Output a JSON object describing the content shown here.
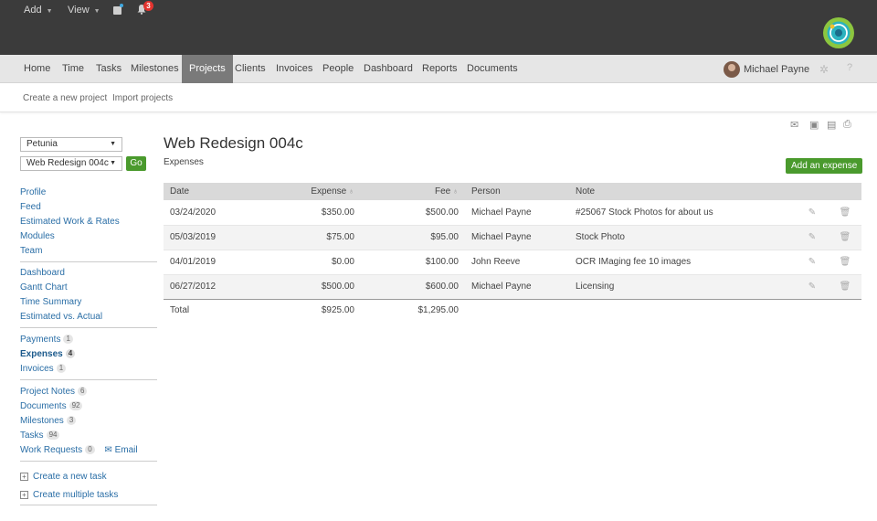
{
  "topbar": {
    "add_label": "Add",
    "view_label": "View",
    "notification_count": "3"
  },
  "nav": {
    "items": [
      "Home",
      "Time",
      "Tasks",
      "Milestones",
      "Projects",
      "Clients",
      "Invoices",
      "People",
      "Dashboard",
      "Reports",
      "Documents"
    ],
    "active": "Projects",
    "user_name": "Michael Payne",
    "help": "?"
  },
  "subbar": {
    "create_project": "Create a new project",
    "import_projects": "Import projects"
  },
  "sidebar": {
    "client_select": "Petunia",
    "project_select": "Web Redesign 004c",
    "go_label": "Go",
    "group1": [
      "Profile",
      "Feed",
      "Estimated Work & Rates",
      "Modules",
      "Team"
    ],
    "group2": [
      "Dashboard",
      "Gantt Chart",
      "Time Summary",
      "Estimated vs. Actual"
    ],
    "payments": {
      "label": "Payments",
      "count": "1"
    },
    "expenses": {
      "label": "Expenses",
      "count": "4"
    },
    "invoices": {
      "label": "Invoices",
      "count": "1"
    },
    "project_notes": {
      "label": "Project Notes",
      "count": "6"
    },
    "documents": {
      "label": "Documents",
      "count": "92"
    },
    "milestones": {
      "label": "Milestones",
      "count": "3"
    },
    "tasks": {
      "label": "Tasks",
      "count": "94"
    },
    "work_requests": {
      "label": "Work Requests",
      "count": "0"
    },
    "email_label": "Email",
    "create_task": "Create a new task",
    "create_multiple": "Create multiple tasks"
  },
  "main": {
    "title": "Web Redesign 004c",
    "subtitle": "Expenses",
    "add_expense_label": "Add an expense",
    "columns": {
      "date": "Date",
      "expense": "Expense",
      "fee": "Fee",
      "person": "Person",
      "note": "Note"
    },
    "rows": [
      {
        "date": "03/24/2020",
        "expense": "$350.00",
        "fee": "$500.00",
        "person": "Michael Payne",
        "note": "#25067 Stock Photos for about us"
      },
      {
        "date": "05/03/2019",
        "expense": "$75.00",
        "fee": "$95.00",
        "person": "Michael Payne",
        "note": "Stock Photo"
      },
      {
        "date": "04/01/2019",
        "expense": "$0.00",
        "fee": "$100.00",
        "person": "John Reeve",
        "note": "OCR IMaging fee 10 images"
      },
      {
        "date": "06/27/2012",
        "expense": "$500.00",
        "fee": "$600.00",
        "person": "Michael Payne",
        "note": "Licensing"
      }
    ],
    "total": {
      "label": "Total",
      "expense": "$925.00",
      "fee": "$1,295.00"
    }
  },
  "colors": {
    "topbar": "#3b3b3b",
    "navbar": "#e6e6e6",
    "active_tab": "#7a7a7a",
    "accent_green": "#4a9a2d",
    "link_blue": "#2a6ea6",
    "badge_red": "#e3342f"
  }
}
